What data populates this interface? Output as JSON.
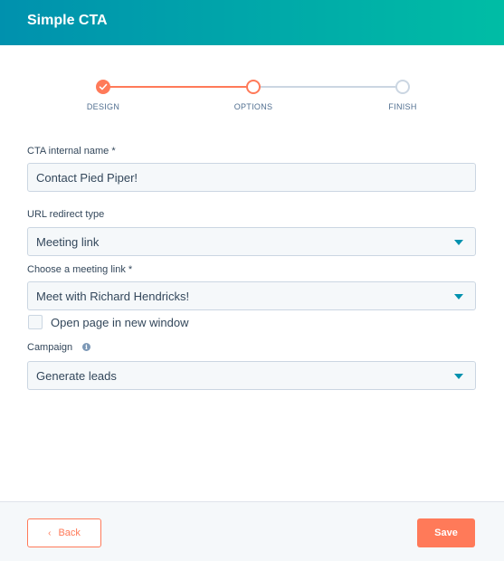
{
  "header": {
    "title": "Simple CTA"
  },
  "stepper": {
    "steps": [
      {
        "label": "DESIGN",
        "state": "complete"
      },
      {
        "label": "OPTIONS",
        "state": "current"
      },
      {
        "label": "FINISH",
        "state": "upcoming"
      }
    ],
    "accent_color": "#ff7a59",
    "inactive_color": "#cbd6e2"
  },
  "form": {
    "internal_name": {
      "label": "CTA internal name *",
      "value": "Contact Pied Piper!"
    },
    "redirect_type": {
      "label": "URL redirect type",
      "value": "Meeting link"
    },
    "meeting_link": {
      "label": "Choose a meeting link *",
      "value": "Meet with Richard Hendricks!"
    },
    "new_window": {
      "label": "Open page in new window",
      "checked": false
    },
    "campaign": {
      "label": "Campaign",
      "value": "Generate leads",
      "info_icon": "info-icon"
    }
  },
  "footer": {
    "back_label": "Back",
    "save_label": "Save"
  },
  "colors": {
    "header_gradient_start": "#0091ae",
    "header_gradient_end": "#00bda5",
    "primary_button": "#ff7a59",
    "dropdown_caret": "#0091ae"
  }
}
